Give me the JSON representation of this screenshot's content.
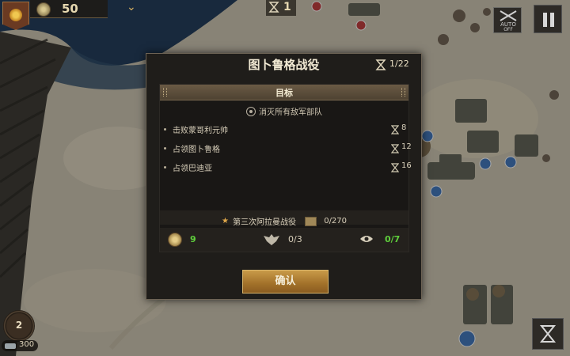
{
  "hud": {
    "coins": "50",
    "turn": "1",
    "auto_label": "AUTO",
    "auto_state": "OFF",
    "bottom_left_badge": "2",
    "bottom_left_resource": "300",
    "icons": {
      "emblem": "sun-emblem-icon",
      "coin": "coin-icon",
      "dropdown": "chevron-down-icon",
      "turn": "hourglass-icon",
      "pause": "pause-icon"
    }
  },
  "dialog": {
    "title": "图卜鲁格战役",
    "turns": "1/22",
    "objectives": {
      "header": "目标",
      "main": "消灭所有敌军部队",
      "sub": [
        {
          "label": "击败蒙哥利元帅",
          "turns": "8"
        },
        {
          "label": "占领图卜鲁格",
          "turns": "12"
        },
        {
          "label": "占领巴迪亚",
          "turns": "16"
        }
      ]
    },
    "campaign": {
      "label": "第三次阿拉曼战役",
      "progress": "0/270"
    },
    "stats": {
      "coins": "9",
      "wings": "0/3",
      "eye": "0/7"
    },
    "confirm_label": "确认"
  },
  "colors": {
    "accent_gold": "#c89a48",
    "good_green": "#5fce3c",
    "panel_bg": "#1f1d1a"
  }
}
